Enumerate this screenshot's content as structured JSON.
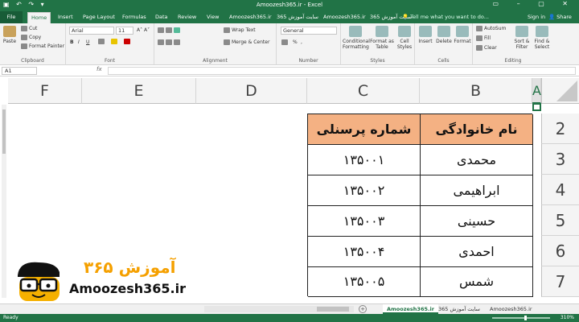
{
  "window": {
    "title": "Amoozesh365.ir - Excel"
  },
  "tabs": {
    "file": "File",
    "home": "Home",
    "insert": "Insert",
    "page_layout": "Page Layout",
    "formulas": "Formulas",
    "data": "Data",
    "review": "Review",
    "view": "View",
    "t1": "Amoozesh365.ir",
    "t2": "سایت آموزش 365",
    "t3": "Amoozesh365.ir",
    "t4": "سایت آموزش 365",
    "tell_me": "Tell me what you want to do...",
    "sign_in": "Sign in",
    "share": "Share"
  },
  "ribbon": {
    "paste": "Paste",
    "cut": "Cut",
    "copy": "Copy",
    "format_painter": "Format Painter",
    "clipboard": "Clipboard",
    "font_name": "Arial",
    "font_size": "11",
    "font_label": "Font",
    "bold": "B",
    "italic": "I",
    "underline": "U",
    "wrap_text": "Wrap Text",
    "merge_center": "Merge & Center",
    "alignment": "Alignment",
    "number_format": "General",
    "percent": "%",
    "comma": ",",
    "number": "Number",
    "conditional_formatting": "Conditional Formatting",
    "format_as_table": "Format as Table",
    "cell_styles": "Cell Styles",
    "styles": "Styles",
    "insert": "Insert",
    "delete": "Delete",
    "format": "Format",
    "cells": "Cells",
    "autosum": "AutoSum",
    "fill": "Fill",
    "clear": "Clear",
    "sort_filter": "Sort & Filter",
    "find_select": "Find & Select",
    "editing": "Editing"
  },
  "formula_bar": {
    "name_box": "A1",
    "fx": "fx"
  },
  "columns": [
    "F",
    "E",
    "D",
    "C",
    "B",
    "A"
  ],
  "rows": [
    "2",
    "3",
    "4",
    "5",
    "6",
    "7"
  ],
  "table": {
    "headers": {
      "family": "نام خانوادگی",
      "personnel": "شماره پرسنلی"
    },
    "rows": [
      {
        "family": "محمدی",
        "personnel": "۱۳۵۰۰۱"
      },
      {
        "family": "ابراهیمی",
        "personnel": "۱۳۵۰۰۲"
      },
      {
        "family": "حسینی",
        "personnel": "۱۳۵۰۰۳"
      },
      {
        "family": "احمدی",
        "personnel": "۱۳۵۰۰۴"
      },
      {
        "family": "شمس",
        "personnel": "۱۳۵۰۰۵"
      }
    ],
    "header_color": "#f4b183"
  },
  "logo": {
    "text": "Amoozesh365.ir",
    "fa_text": "آموزش ۳۶۵",
    "accent": "#f5a000"
  },
  "sheets": {
    "s1": "Amoozesh365.ir",
    "s2": "سایت آموزش 365",
    "s3": "Amoozesh365.ir",
    "add": "+"
  },
  "status": {
    "ready": "Ready",
    "zoom": "310%"
  },
  "colors": {
    "excel_green": "#217346"
  }
}
